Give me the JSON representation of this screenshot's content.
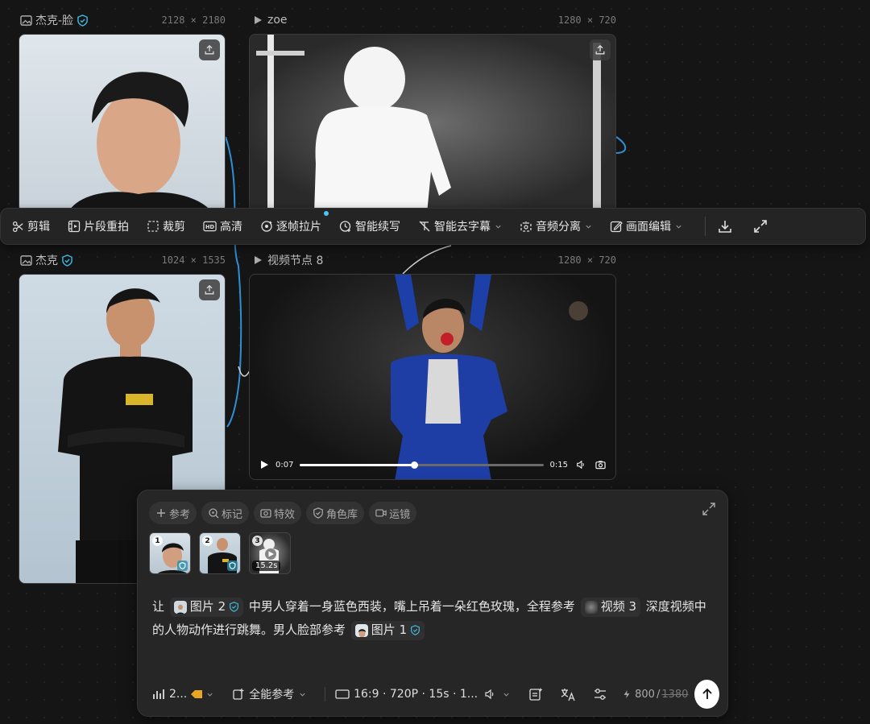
{
  "nodes": [
    {
      "title": "杰克-脸",
      "dims": "2128 × 2180",
      "verified": true
    },
    {
      "title": "zoe",
      "dims": "1280 × 720"
    },
    {
      "title": "杰克",
      "dims": "1024 × 1535",
      "verified": true
    },
    {
      "title": "视频节点 8",
      "dims": "1280 × 720"
    }
  ],
  "toolbar": {
    "items": [
      {
        "label": "剪辑",
        "icon": "scissors-icon"
      },
      {
        "label": "片段重拍",
        "icon": "clip-reshoot-icon"
      },
      {
        "label": "裁剪",
        "icon": "crop-icon"
      },
      {
        "label": "高清",
        "icon": "hd-icon"
      },
      {
        "label": "逐帧拉片",
        "icon": "frame-analysis-icon"
      },
      {
        "label": "智能续写",
        "icon": "smart-continue-icon"
      },
      {
        "label": "智能去字幕",
        "icon": "remove-subtitle-icon"
      },
      {
        "label": "音频分离",
        "icon": "audio-separate-icon"
      },
      {
        "label": "画面编辑",
        "icon": "edit-frame-icon"
      }
    ]
  },
  "video": {
    "current_time": "0:07",
    "duration": "0:15",
    "progress": 0.47
  },
  "composer": {
    "chips": [
      {
        "label": "参考",
        "icon": "plus-icon"
      },
      {
        "label": "标记",
        "icon": "mark-icon"
      },
      {
        "label": "特效",
        "icon": "effects-icon"
      },
      {
        "label": "角色库",
        "icon": "shield-icon"
      },
      {
        "label": "运镜",
        "icon": "camera-motion-icon"
      }
    ],
    "thumbs": [
      {
        "num": "1"
      },
      {
        "num": "2"
      },
      {
        "num": "3",
        "duration": "15.2s"
      }
    ],
    "prompt": {
      "t1": "让",
      "ref_image2": "图片 2",
      "t2": "中男人穿着一身蓝色西装，嘴上吊着一朵红色玫瑰，全程参考",
      "ref_video3": "视频 3",
      "t3": "深度视频中的人物动作进行跳舞。男人脸部参考",
      "ref_image1": "图片 1"
    },
    "bottom": {
      "model": "2...",
      "mode": "全能参考",
      "settings": "16:9 · 720P · 15s · 1...",
      "credits": "800",
      "credits_total": "1380"
    }
  },
  "colors": {
    "accent": "#4fc3f7",
    "shield": "#3fb8e0"
  }
}
